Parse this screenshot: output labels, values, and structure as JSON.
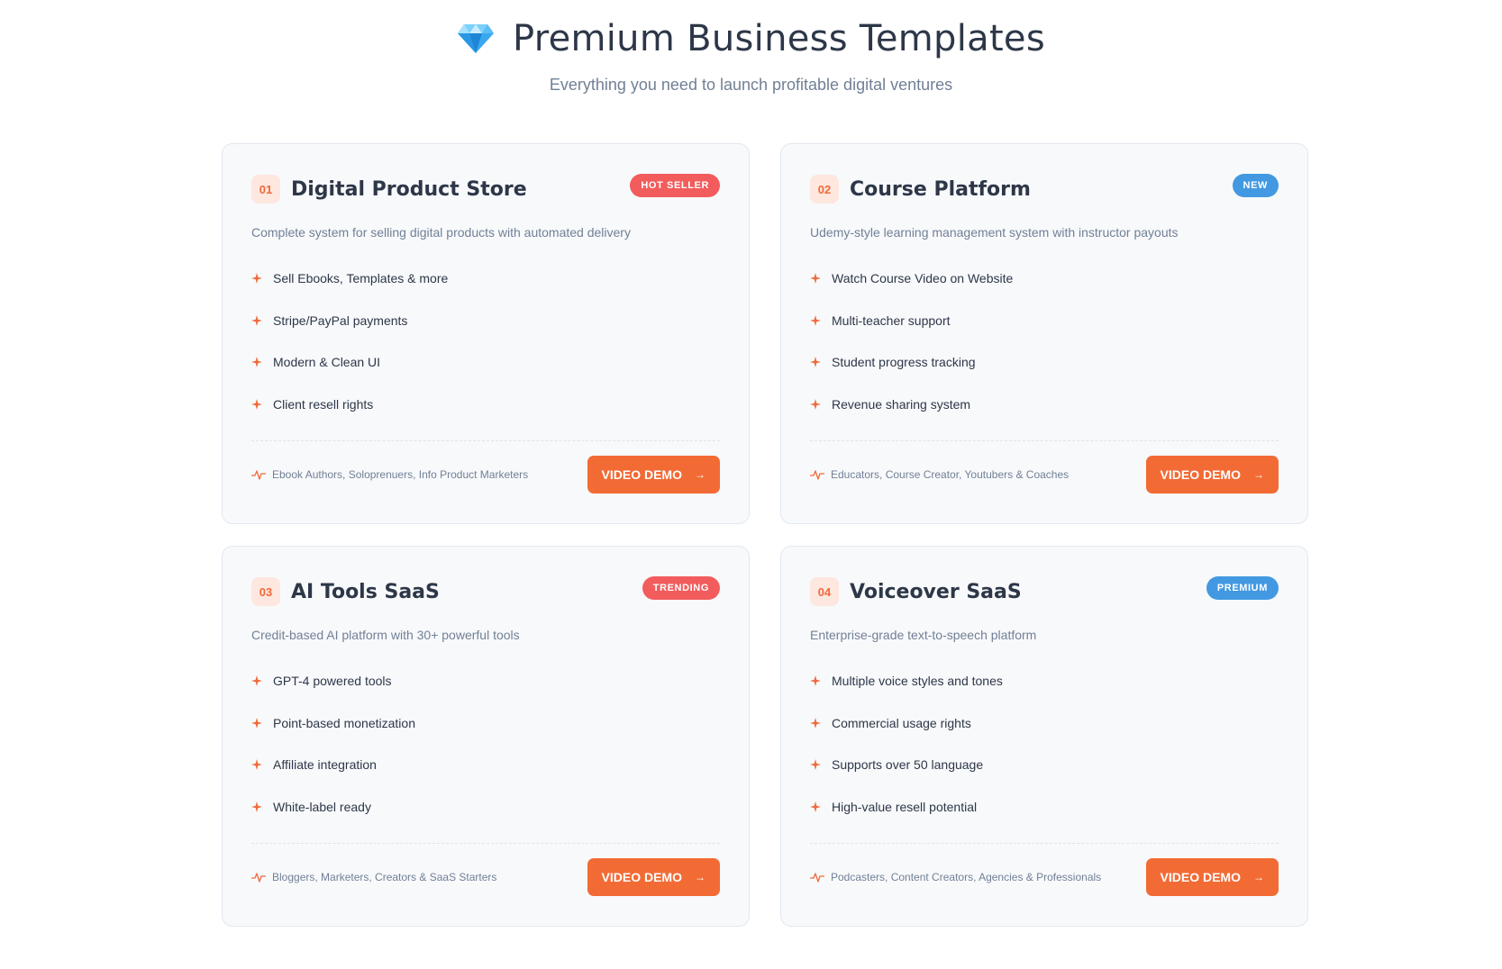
{
  "header": {
    "icon": "gem-icon",
    "title": "Premium Business Templates",
    "subtitle": "Everything you need to launch profitable digital ventures"
  },
  "colors": {
    "accent": "#f26b35",
    "badge_red": "#f25c5c",
    "badge_blue": "#4299e1",
    "card_bg": "#f8f9fb"
  },
  "cards": [
    {
      "number": "01",
      "title": "Digital Product Store",
      "badge": "HOT SELLER",
      "badge_color": "red",
      "description": "Complete system for selling digital products with automated delivery",
      "features": [
        "Sell Ebooks, Templates & more",
        "Stripe/PayPal payments",
        "Modern & Clean UI",
        "Client resell rights"
      ],
      "audience": "Ebook Authors, Soloprenuers, Info Product Marketers",
      "button": "VIDEO DEMO"
    },
    {
      "number": "02",
      "title": "Course Platform",
      "badge": "NEW",
      "badge_color": "blue",
      "description": "Udemy-style learning management system with instructor payouts",
      "features": [
        "Watch Course Video on Website",
        "Multi-teacher support",
        "Student progress tracking",
        "Revenue sharing system"
      ],
      "audience": "Educators, Course Creator, Youtubers & Coaches",
      "button": "VIDEO DEMO"
    },
    {
      "number": "03",
      "title": "AI Tools SaaS",
      "badge": "TRENDING",
      "badge_color": "red",
      "description": "Credit-based AI platform with 30+ powerful tools",
      "features": [
        "GPT-4 powered tools",
        "Point-based monetization",
        "Affiliate integration",
        "White-label ready"
      ],
      "audience": "Bloggers, Marketers, Creators & SaaS Starters",
      "button": "VIDEO DEMO"
    },
    {
      "number": "04",
      "title": "Voiceover SaaS",
      "badge": "PREMIUM",
      "badge_color": "blue",
      "description": "Enterprise-grade text-to-speech platform",
      "features": [
        "Multiple voice styles and tones",
        "Commercial usage rights",
        "Supports over 50 language",
        "High-value resell potential"
      ],
      "audience": "Podcasters, Content Creators, Agencies & Professionals",
      "button": "VIDEO DEMO"
    }
  ]
}
